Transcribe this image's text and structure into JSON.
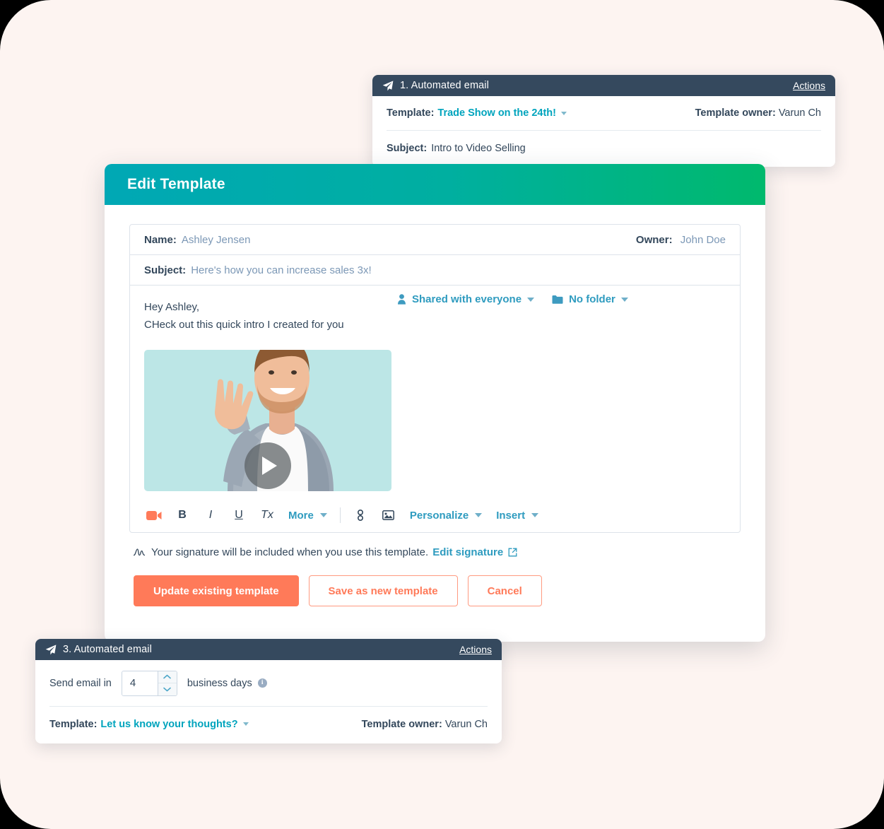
{
  "theme": {
    "page_background": "#FDF4F1",
    "modal_header_gradient_start": "#00A8B5",
    "modal_header_gradient_end": "#00B96D",
    "card_header_navy": "#35495E",
    "link_teal": "#2E9BBF",
    "primary_orange": "#FF7A59",
    "video_background": "#BCE6E6"
  },
  "card_top": {
    "icon": "paper-plane-icon",
    "title": "1. Automated email",
    "actions_label": "Actions",
    "template_label": "Template:",
    "template_value": "Trade Show on the 24th!",
    "owner_label": "Template owner:",
    "owner_value": "Varun Ch",
    "subject_label": "Subject:",
    "subject_value": "Intro to Video Selling"
  },
  "card_bottom": {
    "icon": "paper-plane-icon",
    "title": "3. Automated email",
    "actions_label": "Actions",
    "delay_prefix": "Send email in",
    "delay_value": "4",
    "delay_suffix": "business days",
    "info_glyph": "i",
    "template_label": "Template:",
    "template_value": "Let us know your thoughts?",
    "owner_label": "Template owner:",
    "owner_value": "Varun Ch"
  },
  "modal": {
    "title": "Edit Template",
    "fields": {
      "name_label": "Name:",
      "name_value": "Ashley Jensen",
      "owner_label": "Owner:",
      "owner_value": "John Doe",
      "subject_label": "Subject:",
      "subject_value": "Here's how you can increase sales 3x!"
    },
    "share": {
      "visibility_icon": "person-icon",
      "visibility_label": "Shared with everyone",
      "folder_icon": "folder-icon",
      "folder_label": "No folder"
    },
    "body": {
      "line1": "Hey Ashley,",
      "line2": "CHeck out this quick intro I created for you"
    },
    "video": {
      "play_icon": "play-icon",
      "alt": "waving-person-thumbnail"
    },
    "toolbar": {
      "video_icon": "video-camera-icon",
      "bold": "B",
      "italic": "I",
      "underline": "U",
      "clear_format": "Tx",
      "more_label": "More",
      "link_icon": "link-icon",
      "image_icon": "image-icon",
      "personalize_label": "Personalize",
      "insert_label": "Insert"
    },
    "signature": {
      "icon": "signature-icon",
      "text": "Your signature will be included when you use this template.",
      "link_label": "Edit signature",
      "external_icon": "external-link-icon"
    },
    "buttons": {
      "primary": "Update existing template",
      "secondary": "Save as new template",
      "cancel": "Cancel"
    }
  }
}
